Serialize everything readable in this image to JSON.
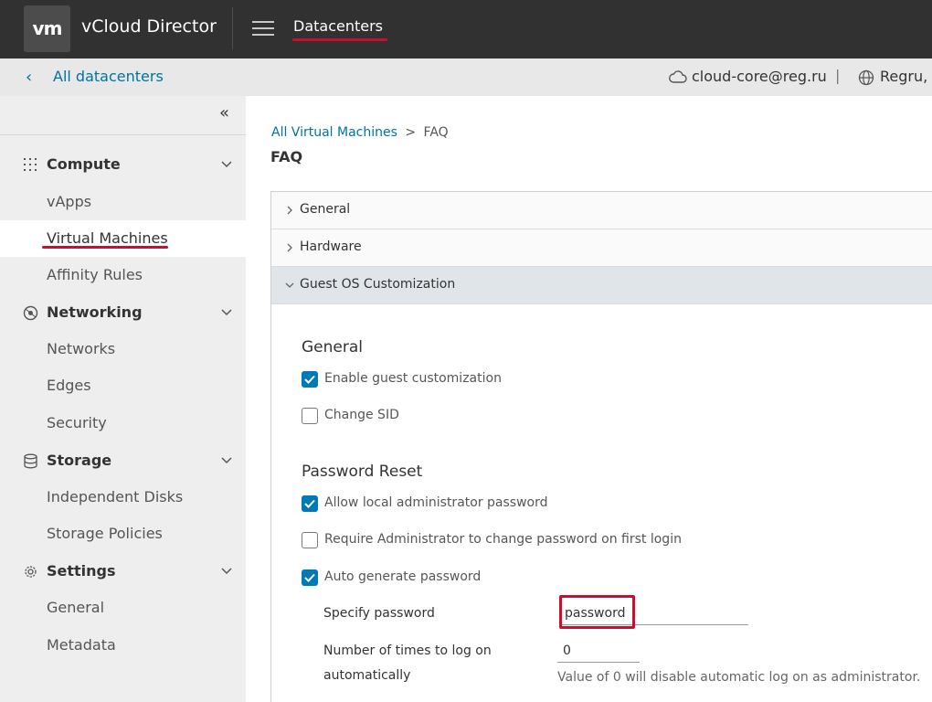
{
  "header": {
    "logo_text": "vm",
    "app_title": "vCloud Director",
    "nav_label": "Datacenters"
  },
  "subheader": {
    "back_label": "All datacenters",
    "site": "cloud-core@reg.ru",
    "separator": "|",
    "org": "Regru,"
  },
  "sidebar": {
    "collapse_icon": "double-chevron-left-icon",
    "groups": [
      {
        "label": "Compute",
        "icon": "grid-icon",
        "items": [
          "vApps",
          "Virtual Machines",
          "Affinity Rules"
        ]
      },
      {
        "label": "Networking",
        "icon": "network-icon",
        "items": [
          "Networks",
          "Edges",
          "Security"
        ]
      },
      {
        "label": "Storage",
        "icon": "database-icon",
        "items": [
          "Independent Disks",
          "Storage Policies"
        ]
      },
      {
        "label": "Settings",
        "icon": "gear-icon",
        "items": [
          "General",
          "Metadata"
        ]
      }
    ],
    "active_item": "Virtual Machines"
  },
  "main": {
    "breadcrumb_link": "All Virtual Machines",
    "breadcrumb_sep": ">",
    "breadcrumb_current": "FAQ",
    "title": "FAQ",
    "accordion": [
      "General",
      "Hardware",
      "Guest OS Customization"
    ],
    "general": {
      "heading": "General",
      "enable_guest": {
        "label": "Enable guest customization",
        "checked": true
      },
      "change_sid": {
        "label": "Change SID",
        "checked": false
      }
    },
    "password_reset": {
      "heading": "Password Reset",
      "allow_local": {
        "label": "Allow local administrator password",
        "checked": true
      },
      "require_change": {
        "label": "Require Administrator to change password on first login",
        "checked": false
      },
      "auto_generate": {
        "label": "Auto generate password",
        "checked": true
      },
      "specify_label": "Specify password",
      "specify_value": "password",
      "logon_label_1": "Number of times to log on",
      "logon_label_2": "automatically",
      "logon_value": "0",
      "logon_help": "Value of 0 will disable automatic log on as administrator."
    }
  },
  "colors": {
    "header_bg": "#313131",
    "link": "#0072a3",
    "checkbox": "#0079b8",
    "highlight": "#c8102e"
  }
}
